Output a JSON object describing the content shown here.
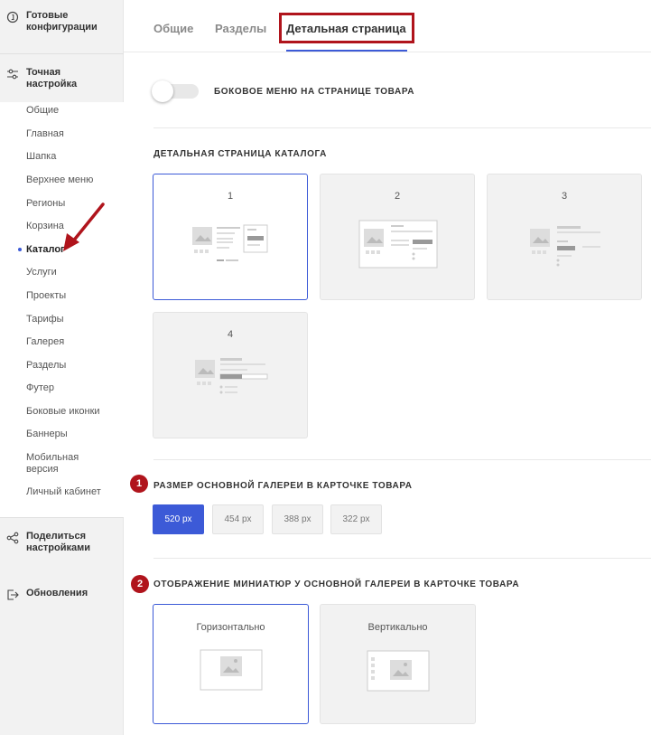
{
  "sidebar": {
    "ready_configs": "Готовые конфигурации",
    "fine_tuning": "Точная настройка",
    "items": [
      "Общие",
      "Главная",
      "Шапка",
      "Верхнее меню",
      "Регионы",
      "Корзина",
      "Каталог",
      "Услуги",
      "Проекты",
      "Тарифы",
      "Галерея",
      "Разделы",
      "Футер",
      "Боковые иконки",
      "Баннеры",
      "Мобильная версия",
      "Личный кабинет"
    ],
    "share": "Поделиться настройками",
    "updates": "Обновления"
  },
  "tabs": [
    "Общие",
    "Разделы",
    "Детальная страница"
  ],
  "toggle_label": "БОКОВОЕ МЕНЮ НА СТРАНИЦЕ ТОВАРА",
  "detail_title": "ДЕТАЛЬНАЯ СТРАНИЦА КАТАЛОГА",
  "layouts": [
    "1",
    "2",
    "3",
    "4"
  ],
  "gallery_size": {
    "badge": "1",
    "title": "РАЗМЕР ОСНОВНОЙ ГАЛЕРЕИ В КАРТОЧКЕ ТОВАРА",
    "options": [
      "520 px",
      "454 px",
      "388 px",
      "322 px"
    ]
  },
  "thumbs": {
    "badge": "2",
    "title": "ОТОБРАЖЕНИЕ МИНИАТЮР У ОСНОВНОЙ ГАЛЕРЕИ В КАРТОЧКЕ ТОВАРА",
    "options": [
      "Горизонтально",
      "Вертикально"
    ]
  },
  "colors": {
    "accent": "#3c5ad7",
    "annotation": "#b0141c"
  }
}
